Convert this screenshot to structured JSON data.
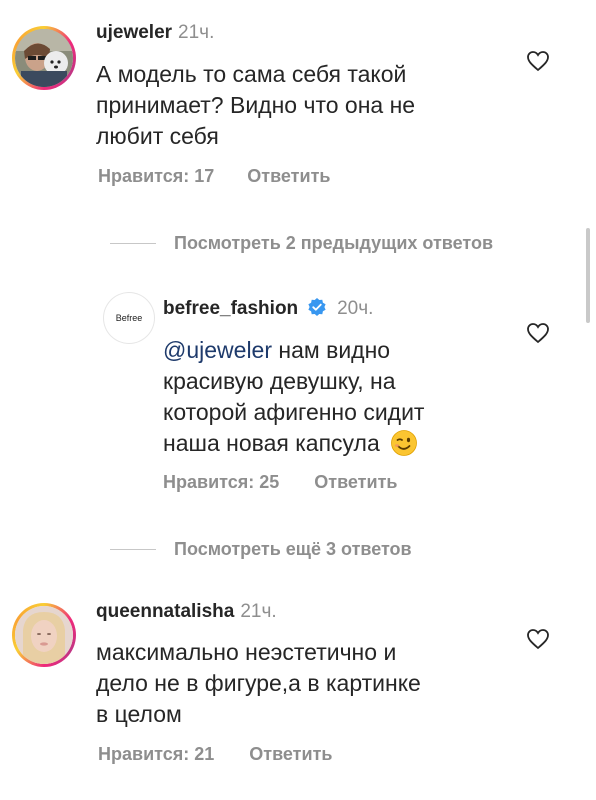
{
  "comments": [
    {
      "username": "ujeweler",
      "time": "21ч.",
      "text_lines": [
        "А модель то сама себя такой",
        "принимает? Видно что она не",
        "любит себя"
      ],
      "likes_label": "Нравится: 17",
      "reply_label": "Ответить",
      "avatar_icon": "user-with-dog-photo"
    },
    {
      "username": "befree_fashion",
      "verified_icon": "verified-badge-icon",
      "time": "20ч.",
      "mention": "@ujeweler",
      "text_first": " нам видно",
      "text_lines": [
        "красивую девушку, на",
        "которой афигенно сидит",
        "наша новая капсула"
      ],
      "emoji": "😉",
      "likes_label": "Нравится: 25",
      "reply_label": "Ответить",
      "avatar_text": "Befree"
    },
    {
      "username": "queennatalisha",
      "time": "21ч.",
      "text_lines": [
        "максимально неэстетично и",
        "дело не в фигуре,а в картинке",
        "в целом"
      ],
      "likes_label": "Нравится: 21",
      "reply_label": "Ответить",
      "avatar_icon": "user-selfie-photo"
    }
  ],
  "view_more": [
    {
      "label": "Посмотреть 2 предыдущих ответов"
    },
    {
      "label": "Посмотреть ещё 3 ответов"
    }
  ],
  "colors": {
    "text": "#262626",
    "muted": "#8e8e8e",
    "mention": "#1e3a6b",
    "verified": "#3897f0"
  }
}
